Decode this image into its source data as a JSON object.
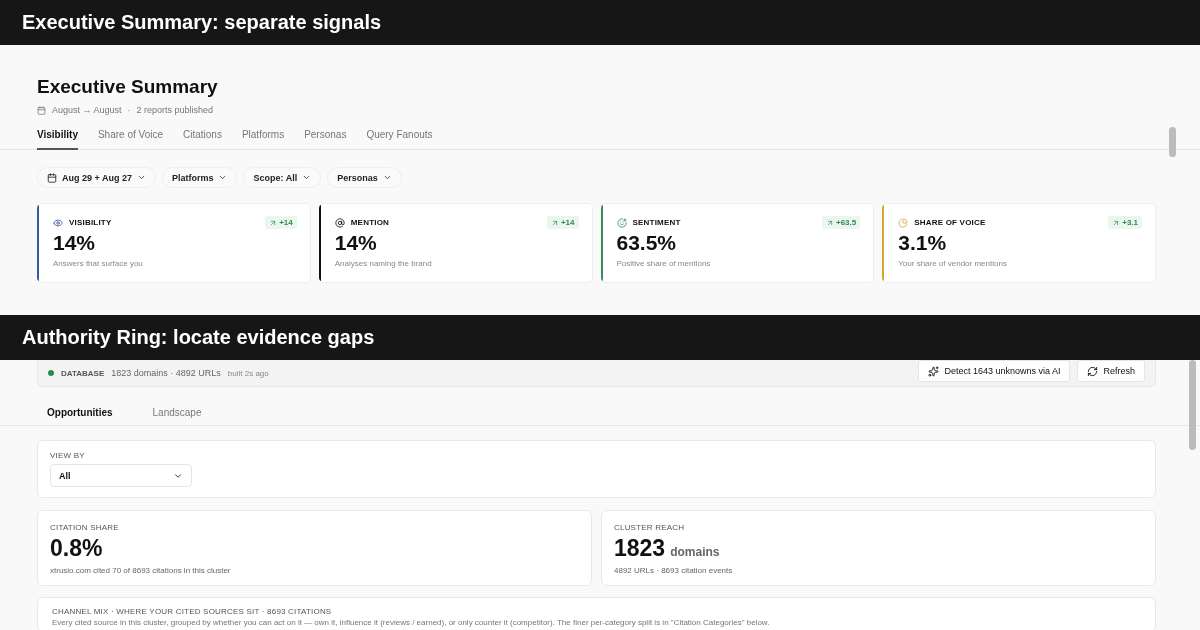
{
  "sections": [
    {
      "caption": "Executive Summary: separate signals"
    },
    {
      "caption": "Authority Ring: locate evidence gaps"
    }
  ],
  "summary": {
    "title": "Executive Summary",
    "date_range": "August → August",
    "separator": "·",
    "reports": "2 reports published",
    "tabs": [
      {
        "label": "Visibility",
        "selected": true
      },
      {
        "label": "Share of Voice",
        "selected": false
      },
      {
        "label": "Citations",
        "selected": false
      },
      {
        "label": "Platforms",
        "selected": false
      },
      {
        "label": "Personas",
        "selected": false
      },
      {
        "label": "Query Fanouts",
        "selected": false
      }
    ],
    "filters": [
      {
        "label": "Aug 29 + Aug 27",
        "kind": "date"
      },
      {
        "label": "Platforms",
        "kind": "plain"
      },
      {
        "label": "Scope: All",
        "kind": "plain"
      },
      {
        "label": "Personas",
        "kind": "plain"
      }
    ],
    "cards": [
      {
        "label": "VISIBILITY",
        "value": "14%",
        "caption": "Answers that surface you",
        "delta": "+14",
        "color": "#3b5b9a"
      },
      {
        "label": "MENTION",
        "value": "14%",
        "caption": "Analyses naming the brand",
        "delta": "+14",
        "color": "#111111"
      },
      {
        "label": "SENTIMENT",
        "value": "63.5%",
        "caption": "Positive share of mentions",
        "delta": "+63.5",
        "color": "#3b8a5a"
      },
      {
        "label": "SHARE OF VOICE",
        "value": "3.1%",
        "caption": "Your share of vendor mentions",
        "delta": "+3.1",
        "color": "#d4a72c"
      }
    ]
  },
  "authority": {
    "database": {
      "label": "DATABASE",
      "stats": "1823 domains · 4892 URLs",
      "built": "built 2s ago",
      "color": "#2f8a4f"
    },
    "buttons": [
      {
        "label": "Detect 1643 unknowns via AI",
        "kind": "detect"
      },
      {
        "label": "Refresh",
        "kind": "refresh"
      }
    ],
    "tabs": [
      {
        "label": "Opportunities",
        "selected": true
      },
      {
        "label": "Landscape",
        "selected": false
      }
    ],
    "view_by": {
      "label": "VIEW BY",
      "value": "All"
    },
    "metrics": [
      {
        "label": "CITATION SHARE",
        "value": "0.8%",
        "caption": "xtrusio.com cited 70 of 8693 citations in this cluster"
      },
      {
        "label": "CLUSTER REACH",
        "value": "1823",
        "unit": "domains",
        "caption": "4892 URLs · 8693 citation events"
      }
    ],
    "channel_mix": {
      "title": "CHANNEL MIX · WHERE YOUR CITED SOURCES SIT · 8693 CITATIONS",
      "description": "Every cited source in this cluster, grouped by whether you can act on it — own it, influence it (reviews / earned), or only counter it (competitor). The finer per-category split is in \"Citation Categories\" below."
    }
  }
}
